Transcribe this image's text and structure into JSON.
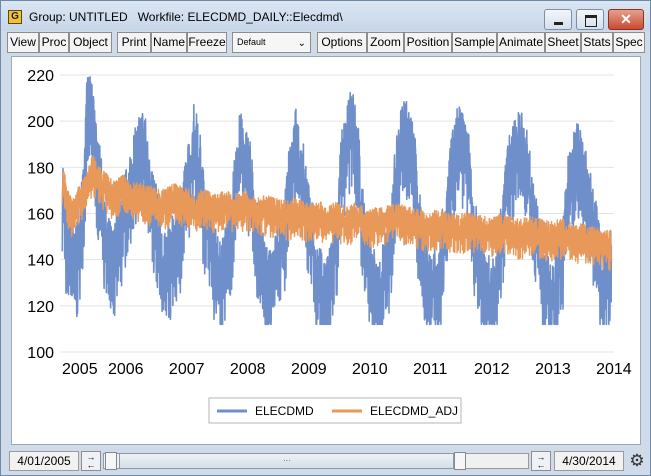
{
  "window": {
    "app_icon": "G",
    "title": "Group: UNTITLED   Workfile: ELECDMD_DAILY::Elecdmd\\",
    "controls": {
      "minimize": "minimize-icon",
      "maximize": "maximize-icon",
      "close": "✕"
    }
  },
  "toolbar": {
    "view": "View",
    "proc": "Proc",
    "object": "Object",
    "print": "Print",
    "name": "Name",
    "freeze": "Freeze",
    "dropdown_value": "Default",
    "options": "Options",
    "zoom": "Zoom",
    "position": "Position",
    "sample": "Sample",
    "animate": "Animate",
    "sheet": "Sheet",
    "stats": "Stats",
    "spec": "Spec"
  },
  "colors": {
    "elecdmd": "#6f8fcb",
    "elecdmd_adj": "#e8995a"
  },
  "chart_data": {
    "type": "line",
    "x_labels": [
      "2005",
      "2006",
      "2007",
      "2008",
      "2009",
      "2010",
      "2011",
      "2012",
      "2013",
      "2014"
    ],
    "x_range": [
      "2005-04-01",
      "2014-04-30"
    ],
    "ylim": [
      100,
      220
    ],
    "yticks": [
      100,
      120,
      140,
      160,
      180,
      200,
      220
    ],
    "grid": true,
    "legend_position": "bottom-center",
    "series": [
      {
        "name": "ELECDMD",
        "approx_points": [
          [
            "2005-04",
            170
          ],
          [
            "2005-05",
            145
          ],
          [
            "2005-07",
            140
          ],
          [
            "2005-08",
            162
          ],
          [
            "2005-09",
            205
          ],
          [
            "2005-10",
            200
          ],
          [
            "2005-11",
            175
          ],
          [
            "2006-01",
            142
          ],
          [
            "2006-02",
            138
          ],
          [
            "2006-03",
            150
          ],
          [
            "2006-05",
            165
          ],
          [
            "2006-06",
            180
          ],
          [
            "2006-08",
            190
          ],
          [
            "2006-09",
            175
          ],
          [
            "2006-10",
            160
          ],
          [
            "2006-12",
            135
          ],
          [
            "2007-01",
            140
          ],
          [
            "2007-03",
            150
          ],
          [
            "2007-05",
            175
          ],
          [
            "2007-06",
            192
          ],
          [
            "2007-07",
            180
          ],
          [
            "2007-08",
            160
          ],
          [
            "2007-10",
            140
          ],
          [
            "2007-11",
            132
          ],
          [
            "2008-01",
            148
          ],
          [
            "2008-02",
            170
          ],
          [
            "2008-03",
            188
          ],
          [
            "2008-05",
            175
          ],
          [
            "2008-06",
            150
          ],
          [
            "2008-08",
            132
          ],
          [
            "2008-09",
            128
          ],
          [
            "2008-11",
            145
          ],
          [
            "2009-01",
            175
          ],
          [
            "2009-02",
            190
          ],
          [
            "2009-03",
            178
          ],
          [
            "2009-05",
            152
          ],
          [
            "2009-06",
            130
          ],
          [
            "2009-08",
            125
          ],
          [
            "2009-10",
            148
          ],
          [
            "2009-11",
            182
          ],
          [
            "2010-01",
            198
          ],
          [
            "2010-02",
            185
          ],
          [
            "2010-03",
            155
          ],
          [
            "2010-05",
            130
          ],
          [
            "2010-06",
            122
          ],
          [
            "2010-08",
            140
          ],
          [
            "2010-10",
            180
          ],
          [
            "2010-11",
            195
          ],
          [
            "2011-01",
            185
          ],
          [
            "2011-02",
            155
          ],
          [
            "2011-04",
            130
          ],
          [
            "2011-06",
            128
          ],
          [
            "2011-07",
            148
          ],
          [
            "2011-09",
            182
          ],
          [
            "2011-10",
            192
          ],
          [
            "2011-12",
            180
          ],
          [
            "2012-01",
            150
          ],
          [
            "2012-03",
            128
          ],
          [
            "2012-05",
            125
          ],
          [
            "2012-06",
            145
          ],
          [
            "2012-08",
            180
          ],
          [
            "2012-10",
            190
          ],
          [
            "2012-11",
            182
          ],
          [
            "2013-01",
            155
          ],
          [
            "2013-03",
            130
          ],
          [
            "2013-04",
            122
          ],
          [
            "2013-06",
            140
          ],
          [
            "2013-08",
            175
          ],
          [
            "2013-09",
            185
          ],
          [
            "2013-11",
            172
          ],
          [
            "2014-01",
            150
          ],
          [
            "2014-02",
            132
          ],
          [
            "2014-03",
            128
          ],
          [
            "2014-04",
            140
          ]
        ]
      },
      {
        "name": "ELECDMD_ADJ",
        "approx_points": [
          [
            "2005-04",
            172
          ],
          [
            "2005-06",
            160
          ],
          [
            "2005-08",
            168
          ],
          [
            "2005-10",
            178
          ],
          [
            "2005-12",
            172
          ],
          [
            "2006-02",
            168
          ],
          [
            "2006-04",
            170
          ],
          [
            "2006-06",
            167
          ],
          [
            "2006-08",
            166
          ],
          [
            "2006-10",
            165
          ],
          [
            "2006-12",
            164
          ],
          [
            "2007-02",
            166
          ],
          [
            "2007-04",
            165
          ],
          [
            "2007-06",
            163
          ],
          [
            "2007-08",
            164
          ],
          [
            "2007-10",
            162
          ],
          [
            "2007-12",
            163
          ],
          [
            "2008-02",
            162
          ],
          [
            "2008-04",
            163
          ],
          [
            "2008-06",
            160
          ],
          [
            "2008-08",
            161
          ],
          [
            "2008-10",
            160
          ],
          [
            "2008-12",
            159
          ],
          [
            "2009-02",
            160
          ],
          [
            "2009-04",
            158
          ],
          [
            "2009-06",
            159
          ],
          [
            "2009-08",
            157
          ],
          [
            "2009-10",
            158
          ],
          [
            "2009-12",
            157
          ],
          [
            "2010-02",
            158
          ],
          [
            "2010-04",
            155
          ],
          [
            "2010-06",
            156
          ],
          [
            "2010-08",
            157
          ],
          [
            "2010-10",
            158
          ],
          [
            "2010-12",
            156
          ],
          [
            "2011-02",
            155
          ],
          [
            "2011-04",
            154
          ],
          [
            "2011-06",
            155
          ],
          [
            "2011-08",
            154
          ],
          [
            "2011-10",
            153
          ],
          [
            "2011-12",
            154
          ],
          [
            "2012-02",
            153
          ],
          [
            "2012-04",
            152
          ],
          [
            "2012-06",
            153
          ],
          [
            "2012-08",
            152
          ],
          [
            "2012-10",
            151
          ],
          [
            "2012-12",
            152
          ],
          [
            "2013-02",
            151
          ],
          [
            "2013-04",
            150
          ],
          [
            "2013-06",
            151
          ],
          [
            "2013-08",
            150
          ],
          [
            "2013-10",
            149
          ],
          [
            "2013-12",
            148
          ],
          [
            "2014-02",
            147
          ],
          [
            "2014-04",
            146
          ]
        ]
      }
    ]
  },
  "bottom": {
    "start_date": "4/01/2005",
    "end_date": "4/30/2014",
    "scroll_grip": "···",
    "gear_icon": "⚙"
  }
}
